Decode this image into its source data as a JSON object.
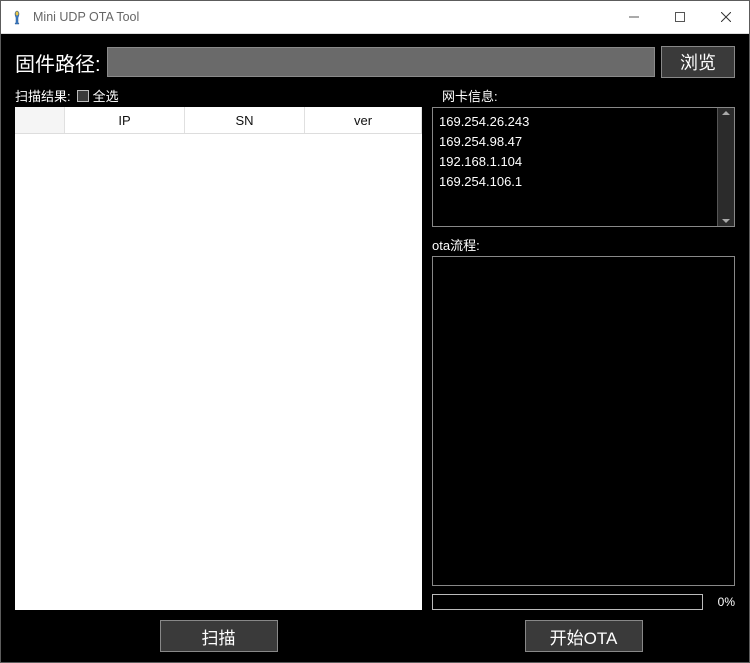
{
  "window": {
    "title": "Mini UDP OTA Tool"
  },
  "path_row": {
    "label": "固件路径:",
    "value": "",
    "browse_label": "浏览"
  },
  "scan": {
    "result_label": "扫描结果:",
    "select_all_label": "全选",
    "columns": {
      "ip": "IP",
      "sn": "SN",
      "ver": "ver"
    },
    "rows": []
  },
  "netcard": {
    "label": "网卡信息:",
    "items": [
      "169.254.26.243",
      "169.254.98.47",
      "192.168.1.104",
      "169.254.106.1"
    ]
  },
  "ota": {
    "label": "ota流程:",
    "log": "",
    "progress_text": "0%"
  },
  "buttons": {
    "scan": "扫描",
    "start_ota": "开始OTA"
  }
}
